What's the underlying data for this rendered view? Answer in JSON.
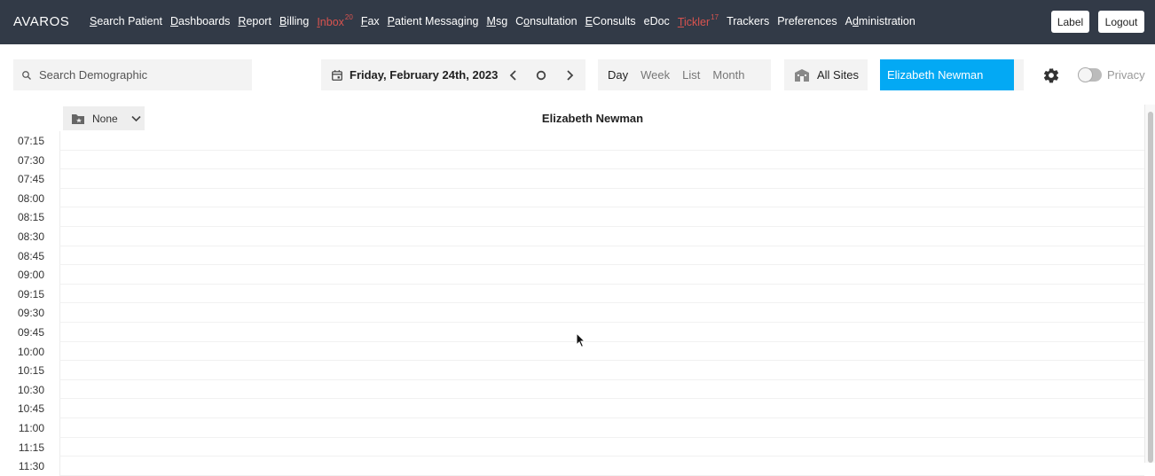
{
  "app": {
    "brand": "AVAROS"
  },
  "nav": {
    "items": [
      {
        "pre": "",
        "ul": "S",
        "post": "earch Patient",
        "badge": "",
        "alert": false
      },
      {
        "pre": "",
        "ul": "D",
        "post": "ashboards",
        "badge": "",
        "alert": false
      },
      {
        "pre": "",
        "ul": "R",
        "post": "eport",
        "badge": "",
        "alert": false
      },
      {
        "pre": "",
        "ul": "B",
        "post": "illing",
        "badge": "",
        "alert": false
      },
      {
        "pre": "",
        "ul": "I",
        "post": "nbox",
        "badge": "20",
        "alert": true
      },
      {
        "pre": "",
        "ul": "F",
        "post": "ax",
        "badge": "",
        "alert": false
      },
      {
        "pre": "",
        "ul": "P",
        "post": "atient Messaging",
        "badge": "",
        "alert": false
      },
      {
        "pre": "",
        "ul": "M",
        "post": "sg",
        "badge": "",
        "alert": false
      },
      {
        "pre": "C",
        "ul": "o",
        "post": "nsultation",
        "badge": "",
        "alert": false
      },
      {
        "pre": "",
        "ul": "E",
        "post": "Consults",
        "badge": "",
        "alert": false
      },
      {
        "pre": "",
        "ul": "",
        "post": "eDoc",
        "badge": "",
        "alert": false
      },
      {
        "pre": "",
        "ul": "T",
        "post": "ickler",
        "badge": "17",
        "alert": true
      },
      {
        "pre": "",
        "ul": "",
        "post": "Trackers",
        "badge": "",
        "alert": false
      },
      {
        "pre": "",
        "ul": "",
        "post": "Preferences",
        "badge": "",
        "alert": false
      },
      {
        "pre": "A",
        "ul": "d",
        "post": "ministration",
        "badge": "",
        "alert": false
      }
    ],
    "label_button": "Label",
    "logout_button": "Logout"
  },
  "search": {
    "placeholder": "Search Demographic",
    "value": ""
  },
  "date": {
    "label": "Friday, February 24th, 2023"
  },
  "views": {
    "day": "Day",
    "week": "Week",
    "list": "List",
    "month": "Month",
    "active": "day"
  },
  "sites": {
    "label": "All Sites"
  },
  "provider": {
    "name": "Elizabeth Newman"
  },
  "privacy": {
    "label": "Privacy",
    "enabled": false
  },
  "schedule": {
    "folder_label": "None",
    "column_title": "Elizabeth Newman",
    "times": [
      "07:15",
      "07:30",
      "07:45",
      "08:00",
      "08:15",
      "08:30",
      "08:45",
      "09:00",
      "09:15",
      "09:30",
      "09:45",
      "10:00",
      "10:15",
      "10:30",
      "10:45",
      "11:00",
      "11:15",
      "11:30"
    ]
  },
  "colors": {
    "topbar": "#323a47",
    "provider_accent": "#03a9f4",
    "alert": "#d9534f"
  }
}
